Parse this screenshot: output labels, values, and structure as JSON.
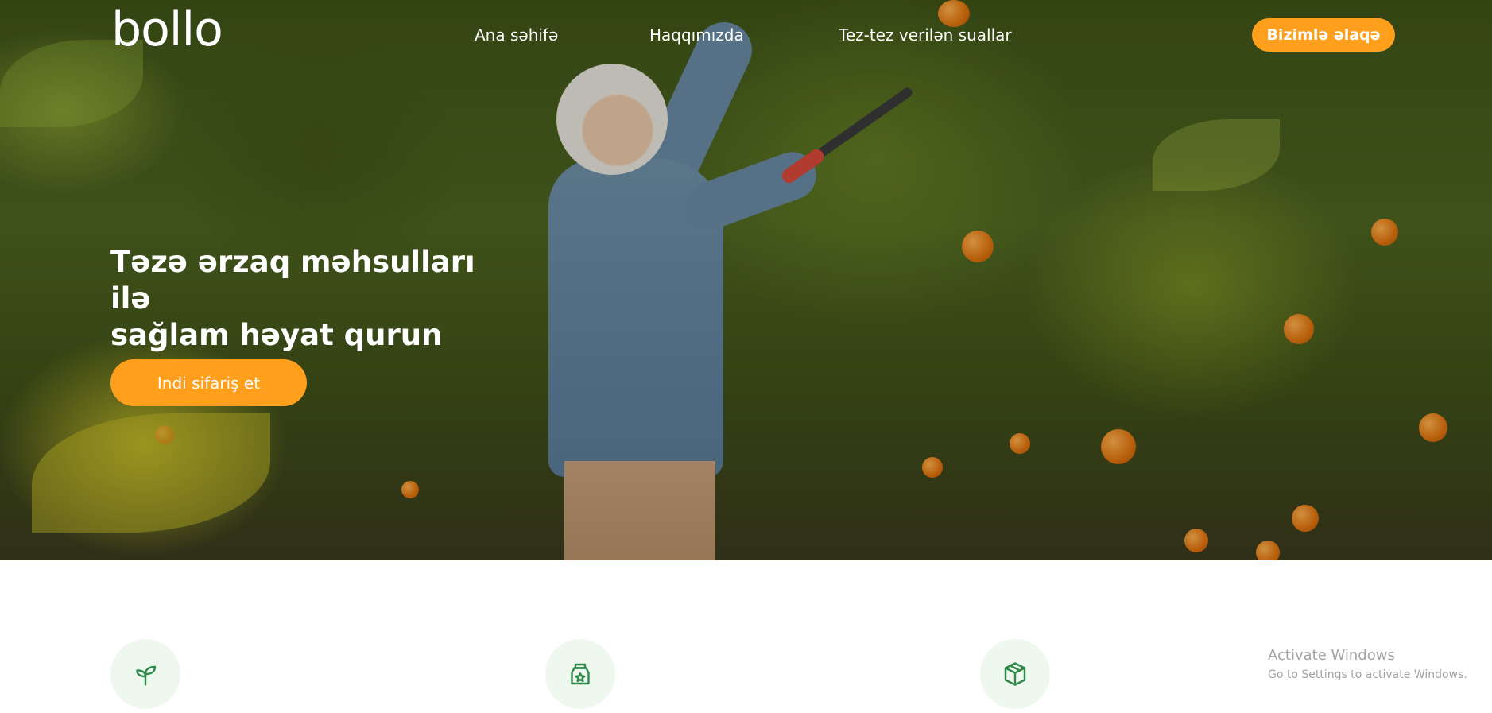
{
  "header": {
    "logo": "bollo",
    "nav": [
      {
        "label": "Ana səhifə"
      },
      {
        "label": "Haqqımızda"
      },
      {
        "label": "Tez-tez verilən suallar"
      }
    ],
    "contact_button": "Bizimlə əlaqə"
  },
  "hero": {
    "title_line1": "Təzə ərzaq məhsulları ilə",
    "title_line2": "sağlam həyat qurun",
    "order_button": "Indi sifariş et"
  },
  "features": {
    "icons": [
      "sprout-icon",
      "badge-star-icon",
      "box-icon"
    ]
  },
  "watermark": {
    "title": "Activate Windows",
    "subtitle": "Go to Settings to activate Windows."
  },
  "colors": {
    "accent": "#ff9f1c",
    "icon_green": "#2f8a4a",
    "icon_bg": "#eef8ef"
  }
}
